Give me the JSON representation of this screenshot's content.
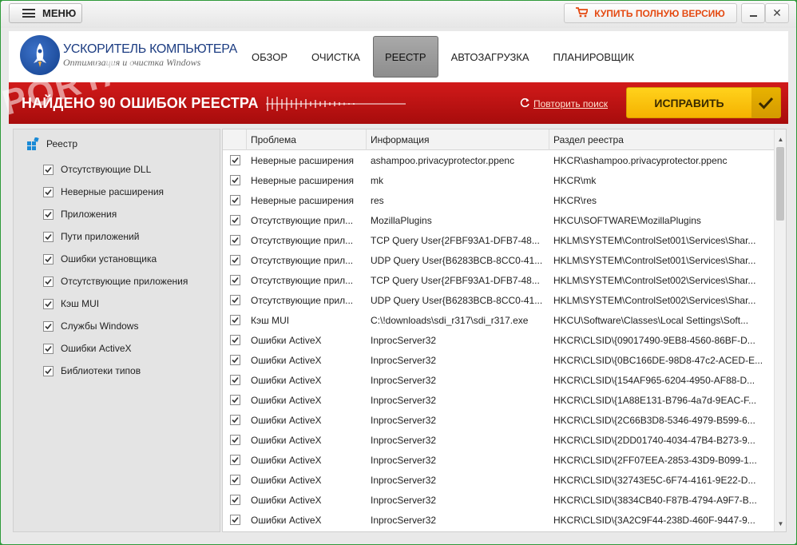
{
  "titlebar": {
    "menu_label": "МЕНЮ",
    "buy_label": "КУПИТЬ ПОЛНУЮ ВЕРСИЮ",
    "close_glyph": "✕"
  },
  "header": {
    "app_title": "УСКОРИТЕЛЬ КОМПЬЮТЕРА",
    "app_subtitle": "Оптимизация и очистка Windows",
    "tabs": [
      {
        "label": "ОБЗОР",
        "active": false
      },
      {
        "label": "ОЧИСТКА",
        "active": false
      },
      {
        "label": "РЕЕСТР",
        "active": true
      },
      {
        "label": "АВТОЗАГРУЗКА",
        "active": false
      },
      {
        "label": "ПЛАНИРОВЩИК",
        "active": false
      }
    ]
  },
  "banner": {
    "title": "НАЙДЕНО 90 ОШИБОК РЕЕСТРА",
    "retry_label": "Повторить поиск",
    "fix_label": "ИСПРАВИТЬ"
  },
  "tree": {
    "root_label": "Реестр",
    "items": [
      {
        "label": "Отсутствующие DLL",
        "checked": true
      },
      {
        "label": "Неверные расширения",
        "checked": true
      },
      {
        "label": "Приложения",
        "checked": true
      },
      {
        "label": "Пути приложений",
        "checked": true
      },
      {
        "label": "Ошибки установщика",
        "checked": true
      },
      {
        "label": "Отсутствующие приложения",
        "checked": true
      },
      {
        "label": "Кэш MUI",
        "checked": true
      },
      {
        "label": "Службы Windows",
        "checked": true
      },
      {
        "label": "Ошибки ActiveX",
        "checked": true
      },
      {
        "label": "Библиотеки типов",
        "checked": true
      }
    ]
  },
  "grid": {
    "columns": [
      "Проблема",
      "Информация",
      "Раздел реестра"
    ],
    "rows": [
      [
        "Неверные расширения",
        "ashampoo.privacyprotector.ppenc",
        "HKCR\\ashampoo.privacyprotector.ppenc"
      ],
      [
        "Неверные расширения",
        "mk",
        "HKCR\\mk"
      ],
      [
        "Неверные расширения",
        "res",
        "HKCR\\res"
      ],
      [
        "Отсутствующие прил...",
        "MozillaPlugins",
        "HKCU\\SOFTWARE\\MozillaPlugins"
      ],
      [
        "Отсутствующие прил...",
        "TCP Query User{2FBF93A1-DFB7-48...",
        "HKLM\\SYSTEM\\ControlSet001\\Services\\Shar..."
      ],
      [
        "Отсутствующие прил...",
        "UDP Query User{B6283BCB-8CC0-41...",
        "HKLM\\SYSTEM\\ControlSet001\\Services\\Shar..."
      ],
      [
        "Отсутствующие прил...",
        "TCP Query User{2FBF93A1-DFB7-48...",
        "HKLM\\SYSTEM\\ControlSet002\\Services\\Shar..."
      ],
      [
        "Отсутствующие прил...",
        "UDP Query User{B6283BCB-8CC0-41...",
        "HKLM\\SYSTEM\\ControlSet002\\Services\\Shar..."
      ],
      [
        "Кэш MUI",
        "C:\\!downloads\\sdi_r317\\sdi_r317.exe",
        "HKCU\\Software\\Classes\\Local Settings\\Soft..."
      ],
      [
        "Ошибки ActiveX",
        "InprocServer32",
        "HKCR\\CLSID\\{09017490-9EB8-4560-86BF-D..."
      ],
      [
        "Ошибки ActiveX",
        "InprocServer32",
        "HKCR\\CLSID\\{0BC166DE-98D8-47c2-ACED-E..."
      ],
      [
        "Ошибки ActiveX",
        "InprocServer32",
        "HKCR\\CLSID\\{154AF965-6204-4950-AF88-D..."
      ],
      [
        "Ошибки ActiveX",
        "InprocServer32",
        "HKCR\\CLSID\\{1A88E131-B796-4a7d-9EAC-F..."
      ],
      [
        "Ошибки ActiveX",
        "InprocServer32",
        "HKCR\\CLSID\\{2C66B3D8-5346-4979-B599-6..."
      ],
      [
        "Ошибки ActiveX",
        "InprocServer32",
        "HKCR\\CLSID\\{2DD01740-4034-47B4-B273-9..."
      ],
      [
        "Ошибки ActiveX",
        "InprocServer32",
        "HKCR\\CLSID\\{2FF07EEA-2853-43D9-B099-1..."
      ],
      [
        "Ошибки ActiveX",
        "InprocServer32",
        "HKCR\\CLSID\\{32743E5C-6F74-4161-9E22-D..."
      ],
      [
        "Ошибки ActiveX",
        "InprocServer32",
        "HKCR\\CLSID\\{3834CB40-F87B-4794-A9F7-B..."
      ],
      [
        "Ошибки ActiveX",
        "InprocServer32",
        "HKCR\\CLSID\\{3A2C9F44-238D-460F-9447-9..."
      ]
    ]
  },
  "watermark": "PORTAL",
  "colors": {
    "banner_red": "#c31414",
    "fix_yellow": "#ffc90e",
    "buy_orange": "#e44a12",
    "window_border": "#2f9a3a"
  },
  "icons": {
    "menu": "hamburger-icon",
    "cart": "cart-icon",
    "retry": "refresh-icon",
    "fix": "checkmark-icon",
    "registry": "registry-icon"
  }
}
